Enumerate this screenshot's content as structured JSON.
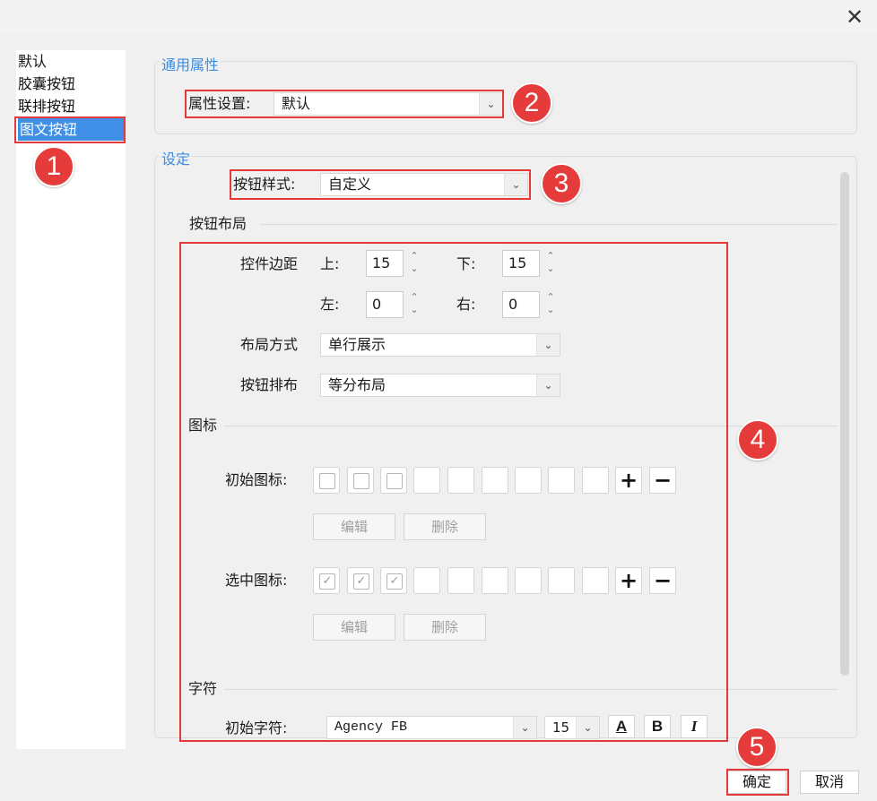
{
  "window": {
    "close_glyph": "✕"
  },
  "sidebar": {
    "items": [
      {
        "label": "默认"
      },
      {
        "label": "胶囊按钮"
      },
      {
        "label": "联排按钮"
      },
      {
        "label": "图文按钮",
        "selected": true
      }
    ]
  },
  "general": {
    "title": "通用属性",
    "property_label": "属性设置:",
    "property_value": "默认"
  },
  "settings": {
    "title": "设定",
    "style_label": "按钮样式:",
    "style_value": "自定义",
    "layout_section": "按钮布局",
    "margin_label": "控件边距",
    "top_label": "上:",
    "top_value": "15",
    "bottom_label": "下:",
    "bottom_value": "15",
    "left_label": "左:",
    "left_value": "0",
    "right_label": "右:",
    "right_value": "0",
    "layout_mode_label": "布局方式",
    "layout_mode_value": "单行展示",
    "arrangement_label": "按钮排布",
    "arrangement_value": "等分布局",
    "icon_section": "图标",
    "initial_icon_label": "初始图标:",
    "selected_icon_label": "选中图标:",
    "edit_label": "编辑",
    "delete_label": "删除",
    "add_glyph": "+",
    "remove_glyph": "−",
    "char_section": "字符",
    "initial_char_label": "初始字符:",
    "font_value": "Agency FB",
    "font_size_value": "15",
    "color_btn": "A",
    "bold_btn": "B",
    "italic_btn": "I"
  },
  "annotations": [
    "1",
    "2",
    "3",
    "4",
    "5"
  ],
  "footer": {
    "ok_label": "确定",
    "cancel_label": "取消"
  },
  "colors": {
    "accent_blue": "#3a8de0",
    "selection_blue": "#3f8fe6",
    "annotation_red": "#e63b3b"
  }
}
